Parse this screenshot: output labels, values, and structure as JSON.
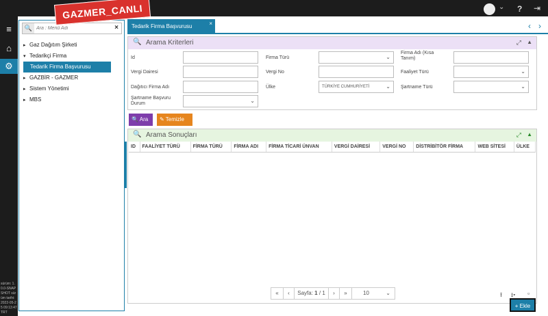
{
  "app": {
    "brand": "GAZMER_CANLI"
  },
  "topbar": {
    "help": "?",
    "exit_icon": "sign-out-icon",
    "chevron": "⌄"
  },
  "version": {
    "text": "sürüm: 1.0.0-SNAPSHOT sürüm tarihi: 2022-05-25 09:13:47 TRT"
  },
  "menu": {
    "search_placeholder": "Ara : Menü Adı",
    "items": [
      {
        "label": "Gaz Dağıtım Şirketi",
        "caret": "▸"
      },
      {
        "label": "Tedarikçi Firma",
        "caret": "▾"
      },
      {
        "label": "Tedarik Firma Başvurusu",
        "caret": ""
      },
      {
        "label": "GAZBİR - GAZMER",
        "caret": "▸"
      },
      {
        "label": "Sistem Yönetimi",
        "caret": "▸"
      },
      {
        "label": "MBS",
        "caret": "▸"
      }
    ]
  },
  "tabs": {
    "active": "Tedarik Firma Başvurusu",
    "close": "×",
    "prev": "‹",
    "next": "›"
  },
  "criteria": {
    "title": "Arama Kriterleri",
    "id": "Id",
    "firma_turu": "Firma Türü",
    "firma_adi_kisa": "Firma Adı (Kısa Tanım)",
    "vergi_dairesi": "Vergi Dairesi",
    "vergi_no": "Vergi No",
    "faaliyet_turu": "Faaliyet Türü",
    "dagitici_firma_adi": "Dağıtıcı Firma Adı",
    "ulke": "Ülke",
    "ulke_value": "TÜRKİYE CUMHURİYETİ",
    "sartname_turu": "Şartname Türü",
    "sartname_basvuru_durum": "Şartname Başvuru Durum"
  },
  "buttons": {
    "ara": "Ara",
    "temizle": "Temizle",
    "ekle": "Ekle"
  },
  "results": {
    "title": "Arama Sonuçları",
    "columns": [
      "ID",
      "FAALİYET TÜRÜ",
      "FİRMA TÜRÜ",
      "FİRMA ADI",
      "FİRMA TİCARİ ÜNVAN",
      "VERGİ DAİRESİ",
      "VERGİ NO",
      "DİSTRİBİTÖR FİRMA",
      "WEB SİTESİ",
      "ÜLKE"
    ]
  },
  "pager": {
    "first": "«",
    "prev": "‹",
    "label": "Sayfa:",
    "current": "1",
    "sep": "/",
    "total": "1",
    "next": "›",
    "last": "»",
    "page_size": "10"
  }
}
